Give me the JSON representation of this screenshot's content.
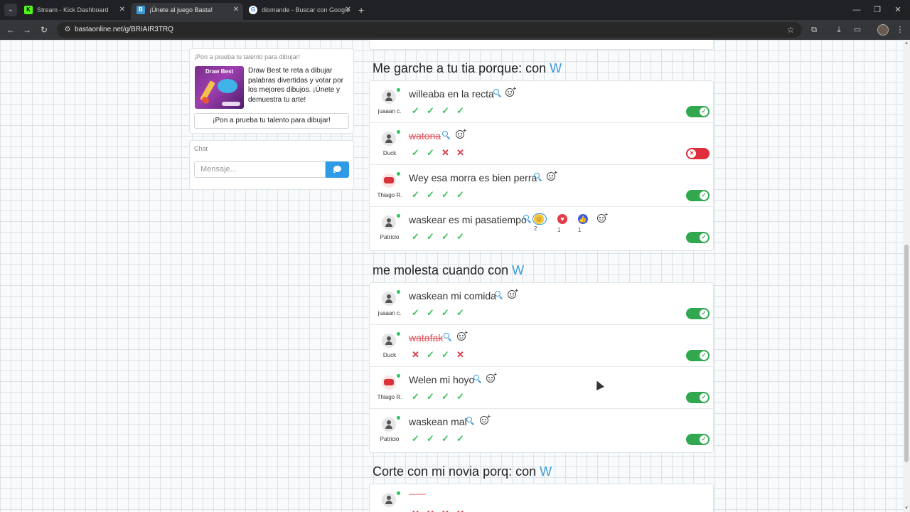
{
  "browser": {
    "tabs": [
      {
        "title": "Stream - Kick Dashboard",
        "favicon": "kick-logo-icon",
        "active": false
      },
      {
        "title": "¡Únete al juego Basta!",
        "favicon": "basta-logo-icon",
        "active": true
      },
      {
        "title": "diomande - Buscar con Google",
        "favicon": "google-logo-icon",
        "active": false
      }
    ],
    "url": "bastaonline.net/g/BRIAIR3TRQ"
  },
  "sidebar": {
    "promo": {
      "title": "¡Pon a prueba tu talento para dibujar!",
      "image_caption": "Draw Best",
      "description": "Draw Best te reta a dibujar palabras divertidas y votar por los mejores dibujos. ¡Únete y demuestra tu arte!",
      "button_label": "¡Pon a prueba tu talento para dibujar!"
    },
    "chat": {
      "label": "Chat",
      "placeholder": "Mensaje..."
    }
  },
  "categories": [
    {
      "prefix": "Me garche a tu tia porque: con",
      "letter": "W",
      "answers": [
        {
          "player": "juaaan c.",
          "avatar": "default",
          "text": "willeaba en la recta",
          "valid": true,
          "votes": [
            "ok",
            "ok",
            "ok",
            "ok"
          ],
          "reactions": []
        },
        {
          "player": "Duck",
          "avatar": "default",
          "text": "watona",
          "valid": false,
          "votes": [
            "ok",
            "ok",
            "no",
            "no"
          ],
          "reactions": []
        },
        {
          "player": "Thiago R.",
          "avatar": "custom",
          "text": "Wey esa morra es bien perra",
          "valid": true,
          "votes": [
            "ok",
            "ok",
            "ok",
            "ok"
          ],
          "reactions": []
        },
        {
          "player": "Patricio",
          "avatar": "default",
          "text": "waskear es mi pasatiempo",
          "valid": true,
          "votes": [
            "ok",
            "ok",
            "ok",
            "ok"
          ],
          "reactions": [
            {
              "type": "laugh",
              "count": "2"
            },
            {
              "type": "heart",
              "count": "1"
            },
            {
              "type": "like",
              "count": "1"
            }
          ]
        }
      ]
    },
    {
      "prefix": "me molesta cuando con",
      "letter": "W",
      "answers": [
        {
          "player": "juaaan c.",
          "avatar": "default",
          "text": "waskean mi comida",
          "valid": true,
          "votes": [
            "ok",
            "ok",
            "ok",
            "ok"
          ],
          "reactions": []
        },
        {
          "player": "Duck",
          "avatar": "default",
          "text": "watafak",
          "valid": true,
          "strike": true,
          "votes": [
            "no",
            "ok",
            "ok",
            "no"
          ],
          "reactions": []
        },
        {
          "player": "Thiago R.",
          "avatar": "custom",
          "text": "Welen mi hoyo",
          "valid": true,
          "votes": [
            "ok",
            "ok",
            "ok",
            "ok"
          ],
          "reactions": []
        },
        {
          "player": "Patricio",
          "avatar": "default",
          "text": "waskean mal",
          "valid": true,
          "votes": [
            "ok",
            "ok",
            "ok",
            "ok"
          ],
          "reactions": []
        }
      ]
    },
    {
      "prefix": "Corte con mi novia porq: con",
      "letter": "W",
      "answers": [
        {
          "player": "",
          "avatar": "default",
          "text": "——",
          "valid": false,
          "votes": [
            "no",
            "no",
            "no",
            "no"
          ],
          "reactions": []
        }
      ]
    }
  ]
}
